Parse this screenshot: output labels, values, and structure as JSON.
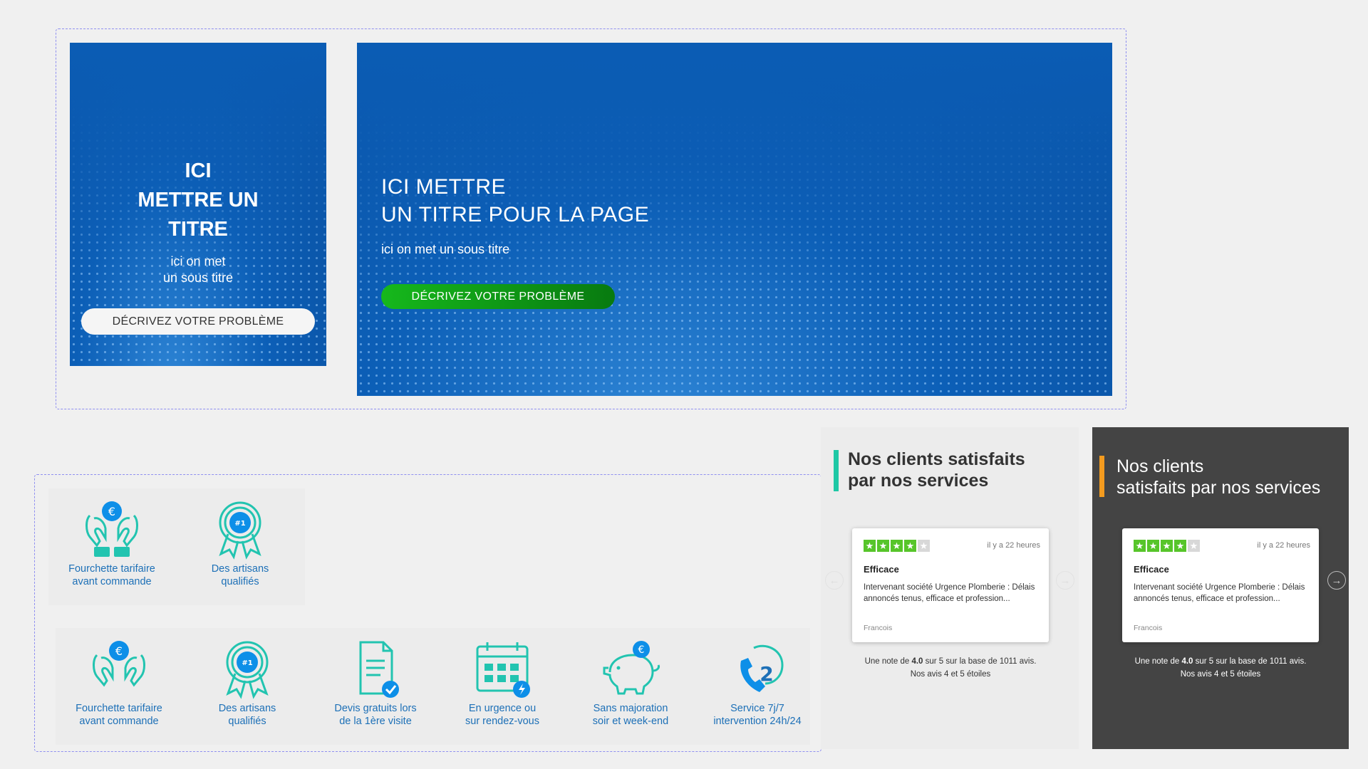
{
  "hero_small": {
    "title_lines": [
      "ICI",
      "METTRE UN",
      "TITRE"
    ],
    "subtitle_lines": [
      "ici on met",
      "un sous titre"
    ],
    "button": "DÉCRIVEZ VOTRE PROBLÈME"
  },
  "hero_large": {
    "title_lines": [
      "ICI METTRE",
      "UN TITRE POUR LA PAGE"
    ],
    "subtitle": "ici on met un sous titre",
    "button": "DÉCRIVEZ VOTRE PROBLÈME"
  },
  "features_small": [
    {
      "icon": "hands-euro-icon",
      "lines": [
        "Fourchette tarifaire",
        "avant commande"
      ]
    },
    {
      "icon": "award-badge-icon",
      "lines": [
        "Des artisans",
        "qualifiés"
      ]
    }
  ],
  "features_full": [
    {
      "icon": "hands-euro-icon",
      "lines": [
        "Fourchette tarifaire",
        "avant commande"
      ]
    },
    {
      "icon": "award-badge-icon",
      "lines": [
        "Des artisans",
        "qualifiés"
      ]
    },
    {
      "icon": "document-check-icon",
      "lines": [
        "Devis gratuits lors",
        "de la 1ère visite"
      ]
    },
    {
      "icon": "calendar-bolt-icon",
      "lines": [
        "En urgence ou",
        "sur rendez-vous"
      ]
    },
    {
      "icon": "piggy-bank-euro-icon",
      "lines": [
        "Sans majoration",
        "soir et week-end"
      ]
    },
    {
      "icon": "phone-24-icon",
      "lines": [
        "Service 7j/7",
        "intervention 24h/24"
      ]
    }
  ],
  "badge_text": "#1",
  "euro_symbol": "€",
  "reviews_light": {
    "title_lines": [
      "Nos clients satisfaits",
      "par nos services"
    ],
    "accent": "#1ec8a5",
    "review": {
      "stars": 4,
      "time_ago": "il y a 22 heures",
      "title": "Efficace",
      "body": "Intervenant société Urgence Plomberie : Délais annoncés tenus, efficace et profession...",
      "author": "Francois"
    },
    "note_prefix": "Une note de ",
    "note_score": "4.0",
    "note_suffix": " sur 5 sur la base de 1011 avis.",
    "note_line2": "Nos avis 4 et 5 étoiles"
  },
  "reviews_dark": {
    "title_lines": [
      "Nos clients",
      "satisfaits par nos services"
    ],
    "accent": "#f39b1f",
    "review": {
      "stars": 4,
      "time_ago": "il y a 22 heures",
      "title": "Efficace",
      "body": "Intervenant société Urgence Plomberie : Délais annoncés tenus, efficace et profession...",
      "author": "Francois"
    },
    "note_prefix": "Une note de ",
    "note_score": "4.0",
    "note_suffix": " sur 5 sur la base de 1011 avis.",
    "note_line2": "Nos avis 4 et 5 étoiles"
  },
  "colors": {
    "star_green": "#57c52a",
    "star_empty": "#d8d8d8",
    "feature_teal": "#22c4b0",
    "feature_blue": "#1d70b7",
    "badge_blue": "#0d8fe8"
  }
}
